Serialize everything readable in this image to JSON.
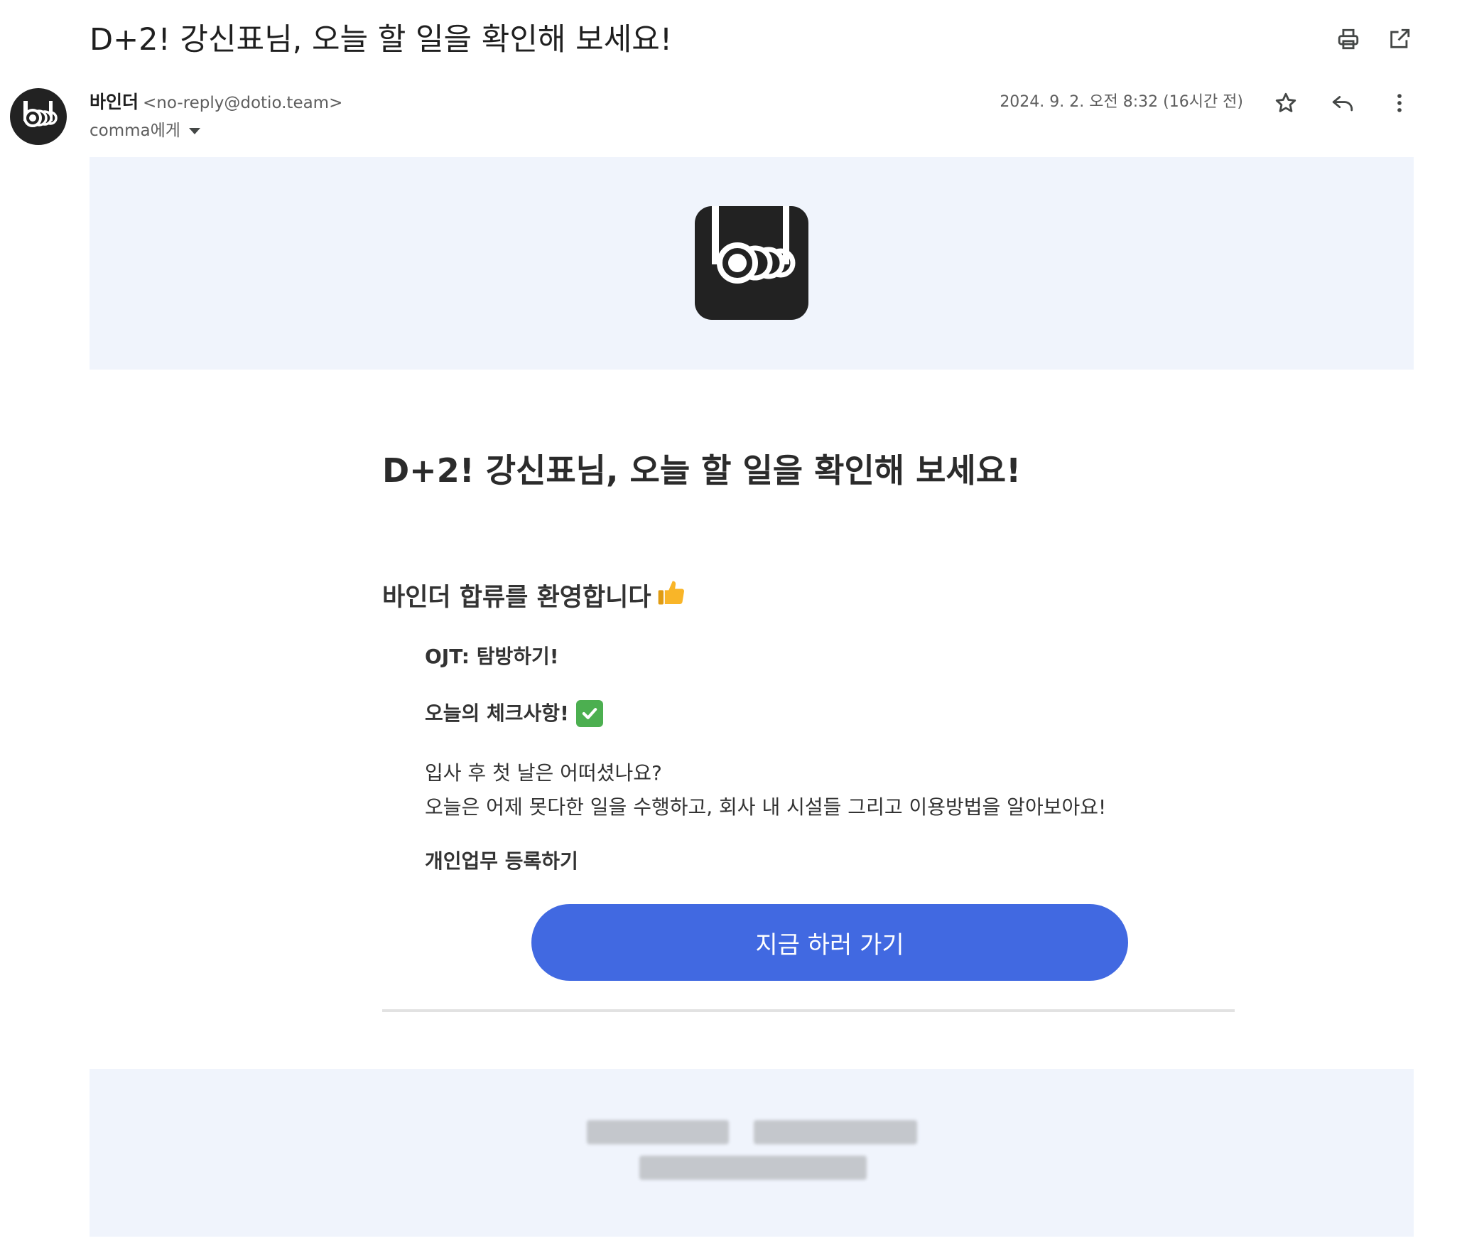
{
  "email": {
    "subject": "D+2! 강신표님, 오늘 할 일을 확인해 보세요!",
    "sender_name": "바인더",
    "sender_email": "<no-reply@dotio.team>",
    "recipient": "comma에게",
    "date": "2024. 9. 2. 오전 8:32 (16시간 전)"
  },
  "icons": {
    "print": "print-icon",
    "open_new": "open-in-new-window-icon",
    "star": "star-icon",
    "reply": "reply-icon",
    "more": "more-vertical-icon"
  },
  "body": {
    "heading": "D+2! 강신표님, 오늘 할 일을 확인해 보세요!",
    "welcome": "바인더 합류를 환영합니다",
    "ojt": "OJT: 탐방하기!",
    "checklist_title": "오늘의 체크사항!",
    "message_line1": "입사 후 첫 날은 어떠셨나요?",
    "message_line2": "오늘은 어제 못다한 일을 수행하고, 회사 내 시설들 그리고 이용방법을 알아보아요!",
    "task_title": "개인업무 등록하기",
    "cta_label": "지금 하러 가기"
  },
  "colors": {
    "band_background": "#f0f4fc",
    "cta_background": "#4169e1",
    "logo_background": "#222222"
  }
}
